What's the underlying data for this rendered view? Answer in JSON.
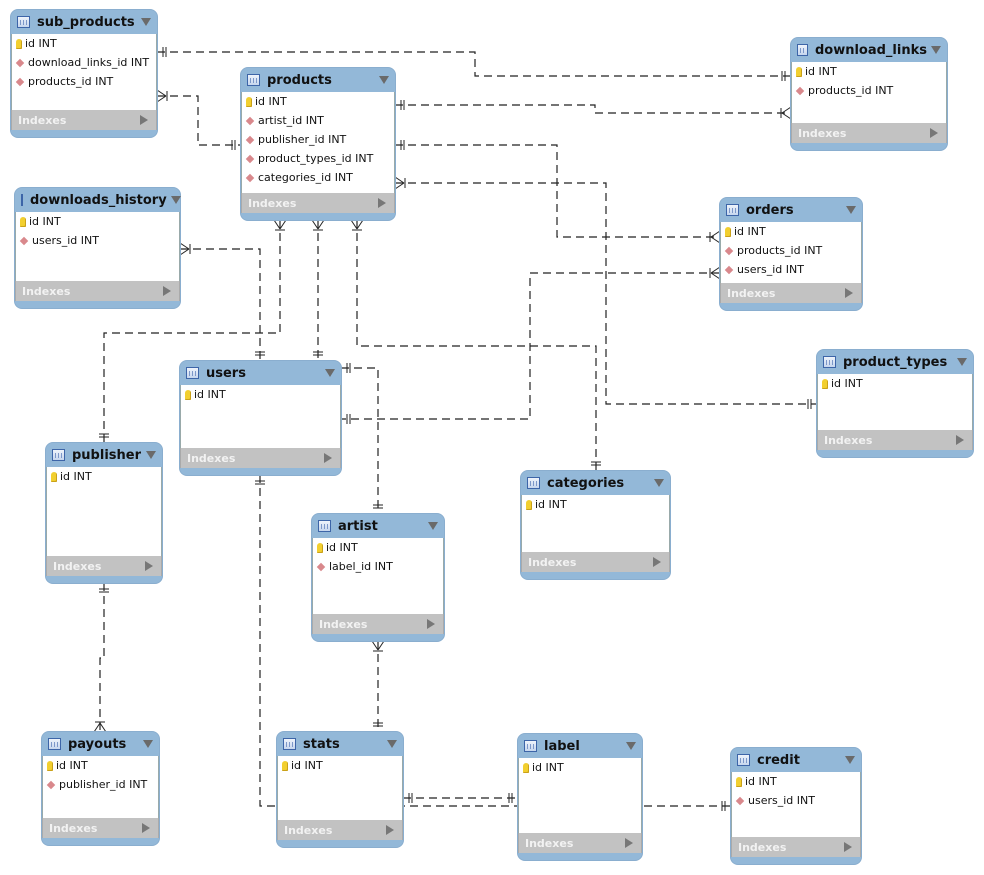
{
  "diagram": {
    "type": "EER diagram",
    "indexes_label": "Indexes",
    "tables": [
      {
        "key": "sub_products",
        "name": "sub_products",
        "columns": [
          {
            "name": "id INT",
            "kind": "pk"
          },
          {
            "name": "download_links_id INT",
            "kind": "fk"
          },
          {
            "name": "products_id INT",
            "kind": "fk"
          }
        ]
      },
      {
        "key": "products",
        "name": "products",
        "columns": [
          {
            "name": "id INT",
            "kind": "pk"
          },
          {
            "name": "artist_id INT",
            "kind": "fk"
          },
          {
            "name": "publisher_id INT",
            "kind": "fk"
          },
          {
            "name": "product_types_id INT",
            "kind": "fk"
          },
          {
            "name": "categories_id INT",
            "kind": "fk"
          }
        ]
      },
      {
        "key": "download_links",
        "name": "download_links",
        "columns": [
          {
            "name": "id INT",
            "kind": "pk"
          },
          {
            "name": "products_id INT",
            "kind": "fk"
          }
        ]
      },
      {
        "key": "downloads_history",
        "name": "downloads_history",
        "columns": [
          {
            "name": "id INT",
            "kind": "pk"
          },
          {
            "name": "users_id INT",
            "kind": "fk"
          }
        ]
      },
      {
        "key": "orders",
        "name": "orders",
        "columns": [
          {
            "name": "id INT",
            "kind": "pk"
          },
          {
            "name": "products_id INT",
            "kind": "fk"
          },
          {
            "name": "users_id INT",
            "kind": "fk"
          }
        ]
      },
      {
        "key": "product_types",
        "name": "product_types",
        "columns": [
          {
            "name": "id INT",
            "kind": "pk"
          }
        ]
      },
      {
        "key": "users",
        "name": "users",
        "columns": [
          {
            "name": "id INT",
            "kind": "pk"
          }
        ]
      },
      {
        "key": "publisher",
        "name": "publisher",
        "columns": [
          {
            "name": "id INT",
            "kind": "pk"
          }
        ]
      },
      {
        "key": "categories",
        "name": "categories",
        "columns": [
          {
            "name": "id INT",
            "kind": "pk"
          }
        ]
      },
      {
        "key": "artist",
        "name": "artist",
        "columns": [
          {
            "name": "id INT",
            "kind": "pk"
          },
          {
            "name": "label_id INT",
            "kind": "fk"
          }
        ]
      },
      {
        "key": "payouts",
        "name": "payouts",
        "columns": [
          {
            "name": "id INT",
            "kind": "pk"
          },
          {
            "name": "publisher_id INT",
            "kind": "fk"
          }
        ]
      },
      {
        "key": "stats",
        "name": "stats",
        "columns": [
          {
            "name": "id INT",
            "kind": "pk"
          }
        ]
      },
      {
        "key": "label",
        "name": "label",
        "columns": [
          {
            "name": "id INT",
            "kind": "pk"
          }
        ]
      },
      {
        "key": "credit",
        "name": "credit",
        "columns": [
          {
            "name": "id INT",
            "kind": "pk"
          },
          {
            "name": "users_id INT",
            "kind": "fk"
          }
        ]
      }
    ],
    "relationships": [
      {
        "from": "sub_products",
        "to": "download_links",
        "from_end": "one",
        "to_end": "one"
      },
      {
        "from": "sub_products",
        "to": "products",
        "from_end": "many",
        "to_end": "one"
      },
      {
        "from": "products",
        "to": "download_links",
        "from_end": "one",
        "to_end": "many"
      },
      {
        "from": "products",
        "to": "orders",
        "from_end": "one",
        "to_end": "many"
      },
      {
        "from": "products",
        "to": "product_types",
        "from_end": "many",
        "to_end": "one"
      },
      {
        "from": "downloads_history",
        "to": "users",
        "from_end": "many",
        "to_end": "one"
      },
      {
        "from": "products",
        "to": "publisher",
        "from_end": "many",
        "to_end": "one"
      },
      {
        "from": "products",
        "to": "artist",
        "from_end": "many",
        "to_end": "one"
      },
      {
        "from": "products",
        "to": "categories",
        "from_end": "many",
        "to_end": "one"
      },
      {
        "from": "orders",
        "to": "users",
        "from_end": "many",
        "to_end": "one"
      },
      {
        "from": "users",
        "to": "artist",
        "from_end": "one",
        "to_end": "one"
      },
      {
        "from": "publisher",
        "to": "payouts",
        "from_end": "one",
        "to_end": "many"
      },
      {
        "from": "artist",
        "to": "label",
        "from_end": "many",
        "to_end": "one"
      },
      {
        "from": "users",
        "to": "credit",
        "from_end": "one",
        "to_end": "one"
      },
      {
        "from": "stats",
        "to": "label",
        "from_end": "one",
        "to_end": "one"
      }
    ]
  }
}
